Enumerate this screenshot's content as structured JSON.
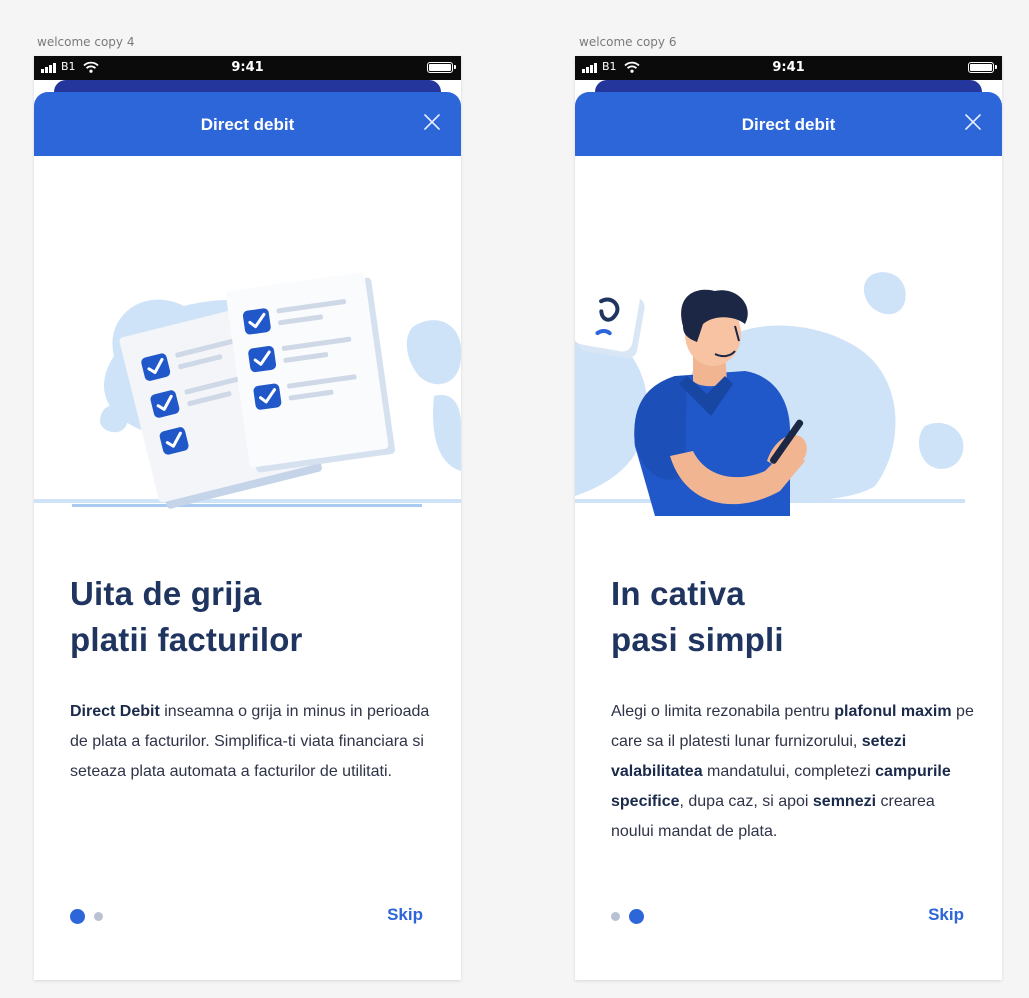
{
  "status_bar": {
    "carrier": "B1",
    "time": "9:41"
  },
  "colors": {
    "primary": "#2d66d9",
    "navy_heading": "#1f3560",
    "stacked_card": "#24359c",
    "light_blob": "#cfe3f8"
  },
  "screens": [
    {
      "artboard_label": "welcome copy 4",
      "header_title": "Direct debit",
      "heading_line1": "Uita de grija",
      "heading_line2": "platii facturilor",
      "description": {
        "p1": "Direct Debit",
        "p2": " inseamna o grija in minus in perioada de plata a facturilor. Simplifica-ti viata financiara si seteaza plata automata a facturilor de utilitati."
      },
      "illustration": "checklist-documents",
      "pagination": {
        "active": 1,
        "total": 2
      },
      "skip_label": "Skip"
    },
    {
      "artboard_label": "welcome copy 6",
      "header_title": "Direct debit",
      "heading_line1": "In cativa",
      "heading_line2": "pasi simpli",
      "description": {
        "p1": "Alegi o limita rezonabila pentru ",
        "p2": "plafonul maxim",
        "p3": " pe care sa il platesti lunar furnizorului, ",
        "p4": "setezi valabilitatea",
        "p5": " mandatului, completezi ",
        "p6": "campurile specifice",
        "p7": ", dupa caz, si apoi ",
        "p8": "semnezi",
        "p9": " crearea noului mandat de plata."
      },
      "illustration": "man-with-phone",
      "pagination": {
        "active": 2,
        "total": 2
      },
      "skip_label": "Skip"
    }
  ]
}
